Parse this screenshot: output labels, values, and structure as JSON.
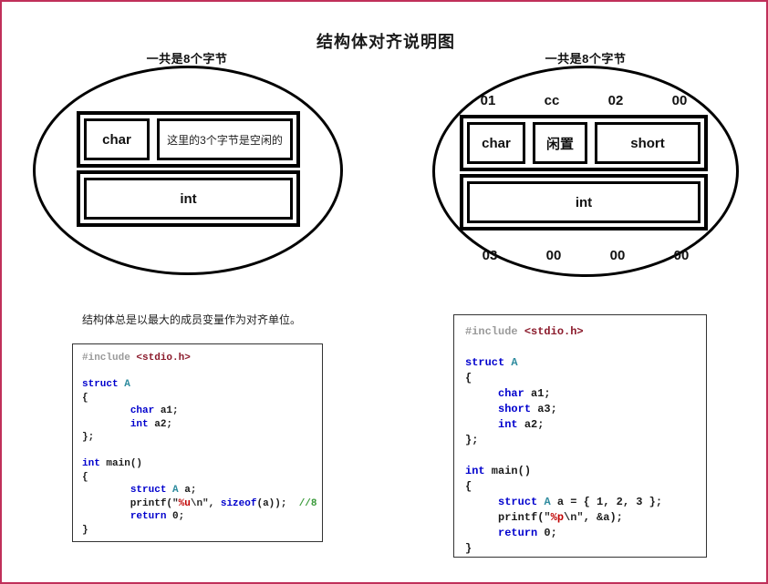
{
  "page": {
    "title": "结构体对齐说明图",
    "border_color": "#c0305a",
    "background": "#ffffff"
  },
  "left_diagram": {
    "top_label": "一共是8个字节",
    "cells": {
      "char": "char",
      "padding_note": "这里的3个字节是空闲的",
      "int": "int"
    }
  },
  "right_diagram": {
    "top_label": "一共是8个字节",
    "hex_top": [
      "01",
      "cc",
      "02",
      "00"
    ],
    "hex_bottom": [
      "03",
      "00",
      "00",
      "00"
    ],
    "cells": {
      "char": "char",
      "idle": "闲置",
      "short": "short",
      "int": "int"
    }
  },
  "mid_caption": "结构体总是以最大的成员变量作为对齐单位。",
  "left_code": {
    "lines": [
      [
        {
          "t": "#include ",
          "c": "pre"
        },
        {
          "t": "<stdio.h>",
          "c": "hdr"
        }
      ],
      [],
      [
        {
          "t": "struct ",
          "c": "kw"
        },
        {
          "t": "A",
          "c": "type"
        }
      ],
      [
        {
          "t": "{",
          "c": "plain"
        }
      ],
      [
        {
          "t": "        ",
          "c": "plain"
        },
        {
          "t": "char",
          "c": "kw"
        },
        {
          "t": " a1;",
          "c": "plain"
        }
      ],
      [
        {
          "t": "        ",
          "c": "plain"
        },
        {
          "t": "int",
          "c": "kw"
        },
        {
          "t": " a2;",
          "c": "plain"
        }
      ],
      [
        {
          "t": "};",
          "c": "plain"
        }
      ],
      [],
      [
        {
          "t": "int",
          "c": "kw"
        },
        {
          "t": " main()",
          "c": "plain"
        }
      ],
      [
        {
          "t": "{",
          "c": "plain"
        }
      ],
      [
        {
          "t": "        ",
          "c": "plain"
        },
        {
          "t": "struct ",
          "c": "kw"
        },
        {
          "t": "A",
          "c": "type"
        },
        {
          "t": " a;",
          "c": "plain"
        }
      ],
      [
        {
          "t": "        printf(",
          "c": "plain"
        },
        {
          "t": "\"",
          "c": "str"
        },
        {
          "t": "%u",
          "c": "fmt"
        },
        {
          "t": "\\n\"",
          "c": "str"
        },
        {
          "t": ", ",
          "c": "plain"
        },
        {
          "t": "sizeof",
          "c": "kw"
        },
        {
          "t": "(a));  ",
          "c": "plain"
        },
        {
          "t": "//8",
          "c": "cmt"
        }
      ],
      [
        {
          "t": "        ",
          "c": "plain"
        },
        {
          "t": "return",
          "c": "kw"
        },
        {
          "t": " 0;",
          "c": "plain"
        }
      ],
      [
        {
          "t": "}",
          "c": "plain"
        }
      ]
    ]
  },
  "right_code": {
    "lines": [
      [
        {
          "t": "#include ",
          "c": "pre"
        },
        {
          "t": "<stdio.h>",
          "c": "hdr"
        }
      ],
      [],
      [
        {
          "t": "struct ",
          "c": "kw"
        },
        {
          "t": "A",
          "c": "type"
        }
      ],
      [
        {
          "t": "{",
          "c": "plain"
        }
      ],
      [
        {
          "t": "     ",
          "c": "plain"
        },
        {
          "t": "char",
          "c": "kw"
        },
        {
          "t": " a1;",
          "c": "plain"
        }
      ],
      [
        {
          "t": "     ",
          "c": "plain"
        },
        {
          "t": "short",
          "c": "kw"
        },
        {
          "t": " a3;",
          "c": "plain"
        }
      ],
      [
        {
          "t": "     ",
          "c": "plain"
        },
        {
          "t": "int",
          "c": "kw"
        },
        {
          "t": " a2;",
          "c": "plain"
        }
      ],
      [
        {
          "t": "};",
          "c": "plain"
        }
      ],
      [],
      [
        {
          "t": "int",
          "c": "kw"
        },
        {
          "t": " main()",
          "c": "plain"
        }
      ],
      [
        {
          "t": "{",
          "c": "plain"
        }
      ],
      [
        {
          "t": "     ",
          "c": "plain"
        },
        {
          "t": "struct ",
          "c": "kw"
        },
        {
          "t": "A",
          "c": "type"
        },
        {
          "t": " a = { 1, 2, 3 };",
          "c": "plain"
        }
      ],
      [
        {
          "t": "     printf(",
          "c": "plain"
        },
        {
          "t": "\"",
          "c": "str"
        },
        {
          "t": "%p",
          "c": "fmt"
        },
        {
          "t": "\\n\"",
          "c": "str"
        },
        {
          "t": ", &a);",
          "c": "plain"
        }
      ],
      [
        {
          "t": "     ",
          "c": "plain"
        },
        {
          "t": "return",
          "c": "kw"
        },
        {
          "t": " 0;",
          "c": "plain"
        }
      ],
      [
        {
          "t": "}",
          "c": "plain"
        }
      ]
    ]
  }
}
